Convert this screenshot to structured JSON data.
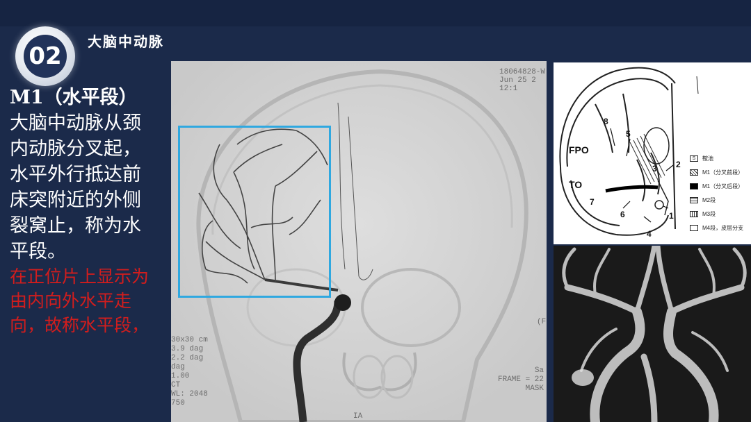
{
  "header": {
    "badge_number": "02",
    "section_title": "大脑中动脉"
  },
  "left_text": {
    "heading": "M1（水平段）",
    "body": "大脑中动脉从颈内动脉分叉起，水平外行抵达前床突附近的外侧裂窝止，称为水平段。",
    "red_note": "在正位片上显示为由内向外水平走向，故称水平段，"
  },
  "angiogram": {
    "overlay_top_right": "18064828-W\nJun 25 2\n12:1",
    "overlay_left": "30x30 cm\n3.9 dag\n2.2 dag\ndag\n1.00\nCT\nWL: 2048\n750",
    "overlay_right_mid": "(FI",
    "overlay_bottom_right": "Sa\nFRAME = 22\nMASK",
    "overlay_bottom": "IA"
  },
  "diagram": {
    "labels": {
      "fpo": "FPO",
      "to": "TO",
      "n1": "1",
      "n2": "2",
      "n3": "3",
      "n4": "4",
      "n5": "5",
      "n6": "6",
      "n7": "7",
      "n8": "8"
    },
    "legend": [
      {
        "symbol": "S",
        "text": "鞍池"
      },
      {
        "symbol": "",
        "text": "M1（分叉前段）"
      },
      {
        "symbol": "",
        "text": "M1（分叉后段）"
      },
      {
        "symbol": "",
        "text": "M2段"
      },
      {
        "symbol": "",
        "text": "M3段"
      },
      {
        "symbol": "",
        "text": "M4段，皮层分支"
      }
    ]
  }
}
